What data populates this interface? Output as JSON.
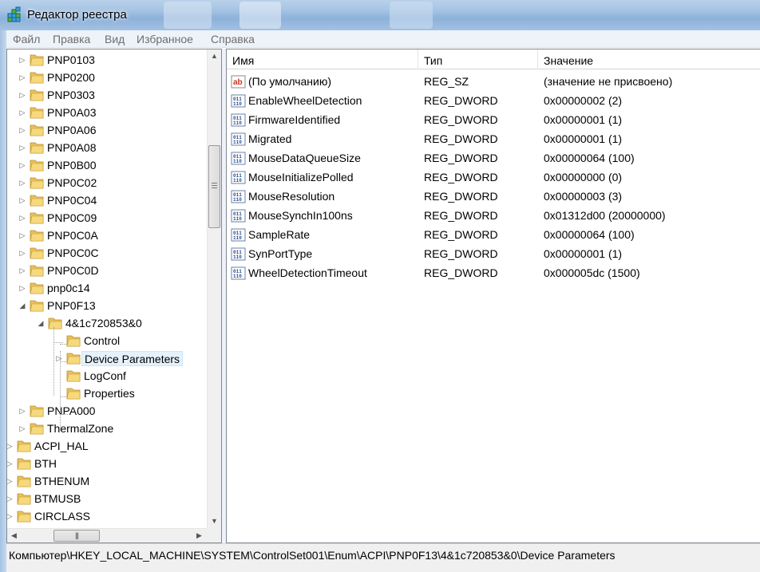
{
  "window": {
    "title": "Редактор реестра"
  },
  "menu": [
    "Файл",
    "Правка",
    "Вид",
    "Избранное",
    "Справка"
  ],
  "tree": {
    "nodes": [
      {
        "label": "PNP0103",
        "expander": "closed",
        "level": 1
      },
      {
        "label": "PNP0200",
        "expander": "closed",
        "level": 1
      },
      {
        "label": "PNP0303",
        "expander": "closed",
        "level": 1
      },
      {
        "label": "PNP0A03",
        "expander": "closed",
        "level": 1
      },
      {
        "label": "PNP0A06",
        "expander": "closed",
        "level": 1
      },
      {
        "label": "PNP0A08",
        "expander": "closed",
        "level": 1
      },
      {
        "label": "PNP0B00",
        "expander": "closed",
        "level": 1
      },
      {
        "label": "PNP0C02",
        "expander": "closed",
        "level": 1
      },
      {
        "label": "PNP0C04",
        "expander": "closed",
        "level": 1
      },
      {
        "label": "PNP0C09",
        "expander": "closed",
        "level": 1
      },
      {
        "label": "PNP0C0A",
        "expander": "closed",
        "level": 1
      },
      {
        "label": "PNP0C0C",
        "expander": "closed",
        "level": 1
      },
      {
        "label": "PNP0C0D",
        "expander": "closed",
        "level": 1
      },
      {
        "label": "pnp0c14",
        "expander": "closed",
        "level": 1
      },
      {
        "label": "PNP0F13",
        "expander": "open",
        "level": 1
      },
      {
        "label": "4&1c720853&0",
        "expander": "open",
        "level": 2
      },
      {
        "label": "Control",
        "expander": "none",
        "level": 3
      },
      {
        "label": "Device Parameters",
        "expander": "closed",
        "level": 3,
        "selected": true
      },
      {
        "label": "LogConf",
        "expander": "none",
        "level": 3
      },
      {
        "label": "Properties",
        "expander": "none",
        "level": 3
      },
      {
        "label": "PNPA000",
        "expander": "closed",
        "level": 1
      },
      {
        "label": "ThermalZone",
        "expander": "closed",
        "level": 1
      },
      {
        "label": "ACPI_HAL",
        "expander": "closed",
        "level": 0
      },
      {
        "label": "BTH",
        "expander": "closed",
        "level": 0
      },
      {
        "label": "BTHENUM",
        "expander": "closed",
        "level": 0
      },
      {
        "label": "BTMUSB",
        "expander": "closed",
        "level": 0
      },
      {
        "label": "CIRCLASS",
        "expander": "closed",
        "level": 0
      }
    ]
  },
  "list": {
    "columns": [
      "Имя",
      "Тип",
      "Значение"
    ],
    "rows": [
      {
        "icon": "string-value-icon",
        "name": "(По умолчанию)",
        "type": "REG_SZ",
        "value": "(значение не присвоено)"
      },
      {
        "icon": "binary-value-icon",
        "name": "EnableWheelDetection",
        "type": "REG_DWORD",
        "value": "0x00000002 (2)"
      },
      {
        "icon": "binary-value-icon",
        "name": "FirmwareIdentified",
        "type": "REG_DWORD",
        "value": "0x00000001 (1)"
      },
      {
        "icon": "binary-value-icon",
        "name": "Migrated",
        "type": "REG_DWORD",
        "value": "0x00000001 (1)"
      },
      {
        "icon": "binary-value-icon",
        "name": "MouseDataQueueSize",
        "type": "REG_DWORD",
        "value": "0x00000064 (100)"
      },
      {
        "icon": "binary-value-icon",
        "name": "MouseInitializePolled",
        "type": "REG_DWORD",
        "value": "0x00000000 (0)"
      },
      {
        "icon": "binary-value-icon",
        "name": "MouseResolution",
        "type": "REG_DWORD",
        "value": "0x00000003 (3)"
      },
      {
        "icon": "binary-value-icon",
        "name": "MouseSynchIn100ns",
        "type": "REG_DWORD",
        "value": "0x01312d00 (20000000)"
      },
      {
        "icon": "binary-value-icon",
        "name": "SampleRate",
        "type": "REG_DWORD",
        "value": "0x00000064 (100)"
      },
      {
        "icon": "binary-value-icon",
        "name": "SynPortType",
        "type": "REG_DWORD",
        "value": "0x00000001 (1)"
      },
      {
        "icon": "binary-value-icon",
        "name": "WheelDetectionTimeout",
        "type": "REG_DWORD",
        "value": "0x000005dc (1500)"
      }
    ]
  },
  "status": {
    "path": "Компьютер\\HKEY_LOCAL_MACHINE\\SYSTEM\\ControlSet001\\Enum\\ACPI\\PNP0F13\\4&1c720853&0\\Device Parameters"
  },
  "colors": {
    "title_bar": "#a5c3e3",
    "selection": "#e5f1fb",
    "folder": "#e8c15c"
  }
}
